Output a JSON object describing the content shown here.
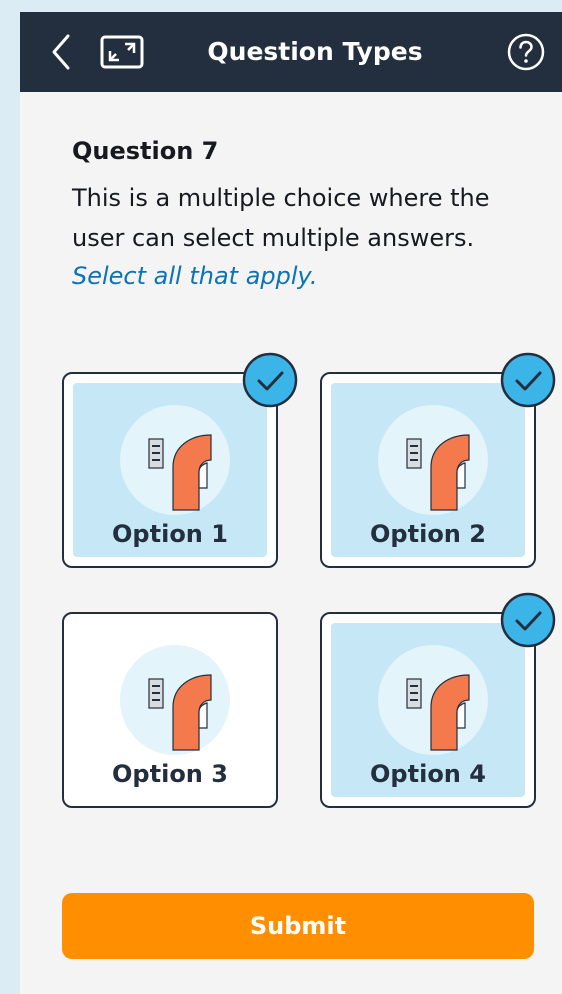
{
  "header": {
    "title": "Question Types",
    "back_icon": "chevron-left-icon",
    "expand_icon": "expand-icon",
    "help_icon": "help-icon"
  },
  "question": {
    "label": "Question 7",
    "text": "This is a multiple choice where the user can select multiple answers.",
    "hint": "Select all that apply."
  },
  "options": [
    {
      "label": "Option 1",
      "selected": true
    },
    {
      "label": "Option 2",
      "selected": true
    },
    {
      "label": "Option 3",
      "selected": false
    },
    {
      "label": "Option 4",
      "selected": true
    }
  ],
  "submit_label": "Submit",
  "colors": {
    "header_bg": "#232f3e",
    "selected_fill": "#c6e8f6",
    "check_fill": "#3bb5e8",
    "accent_text": "#0b73b6",
    "submit_bg": "#ff8f00",
    "illustration_orange": "#f47a4d"
  }
}
